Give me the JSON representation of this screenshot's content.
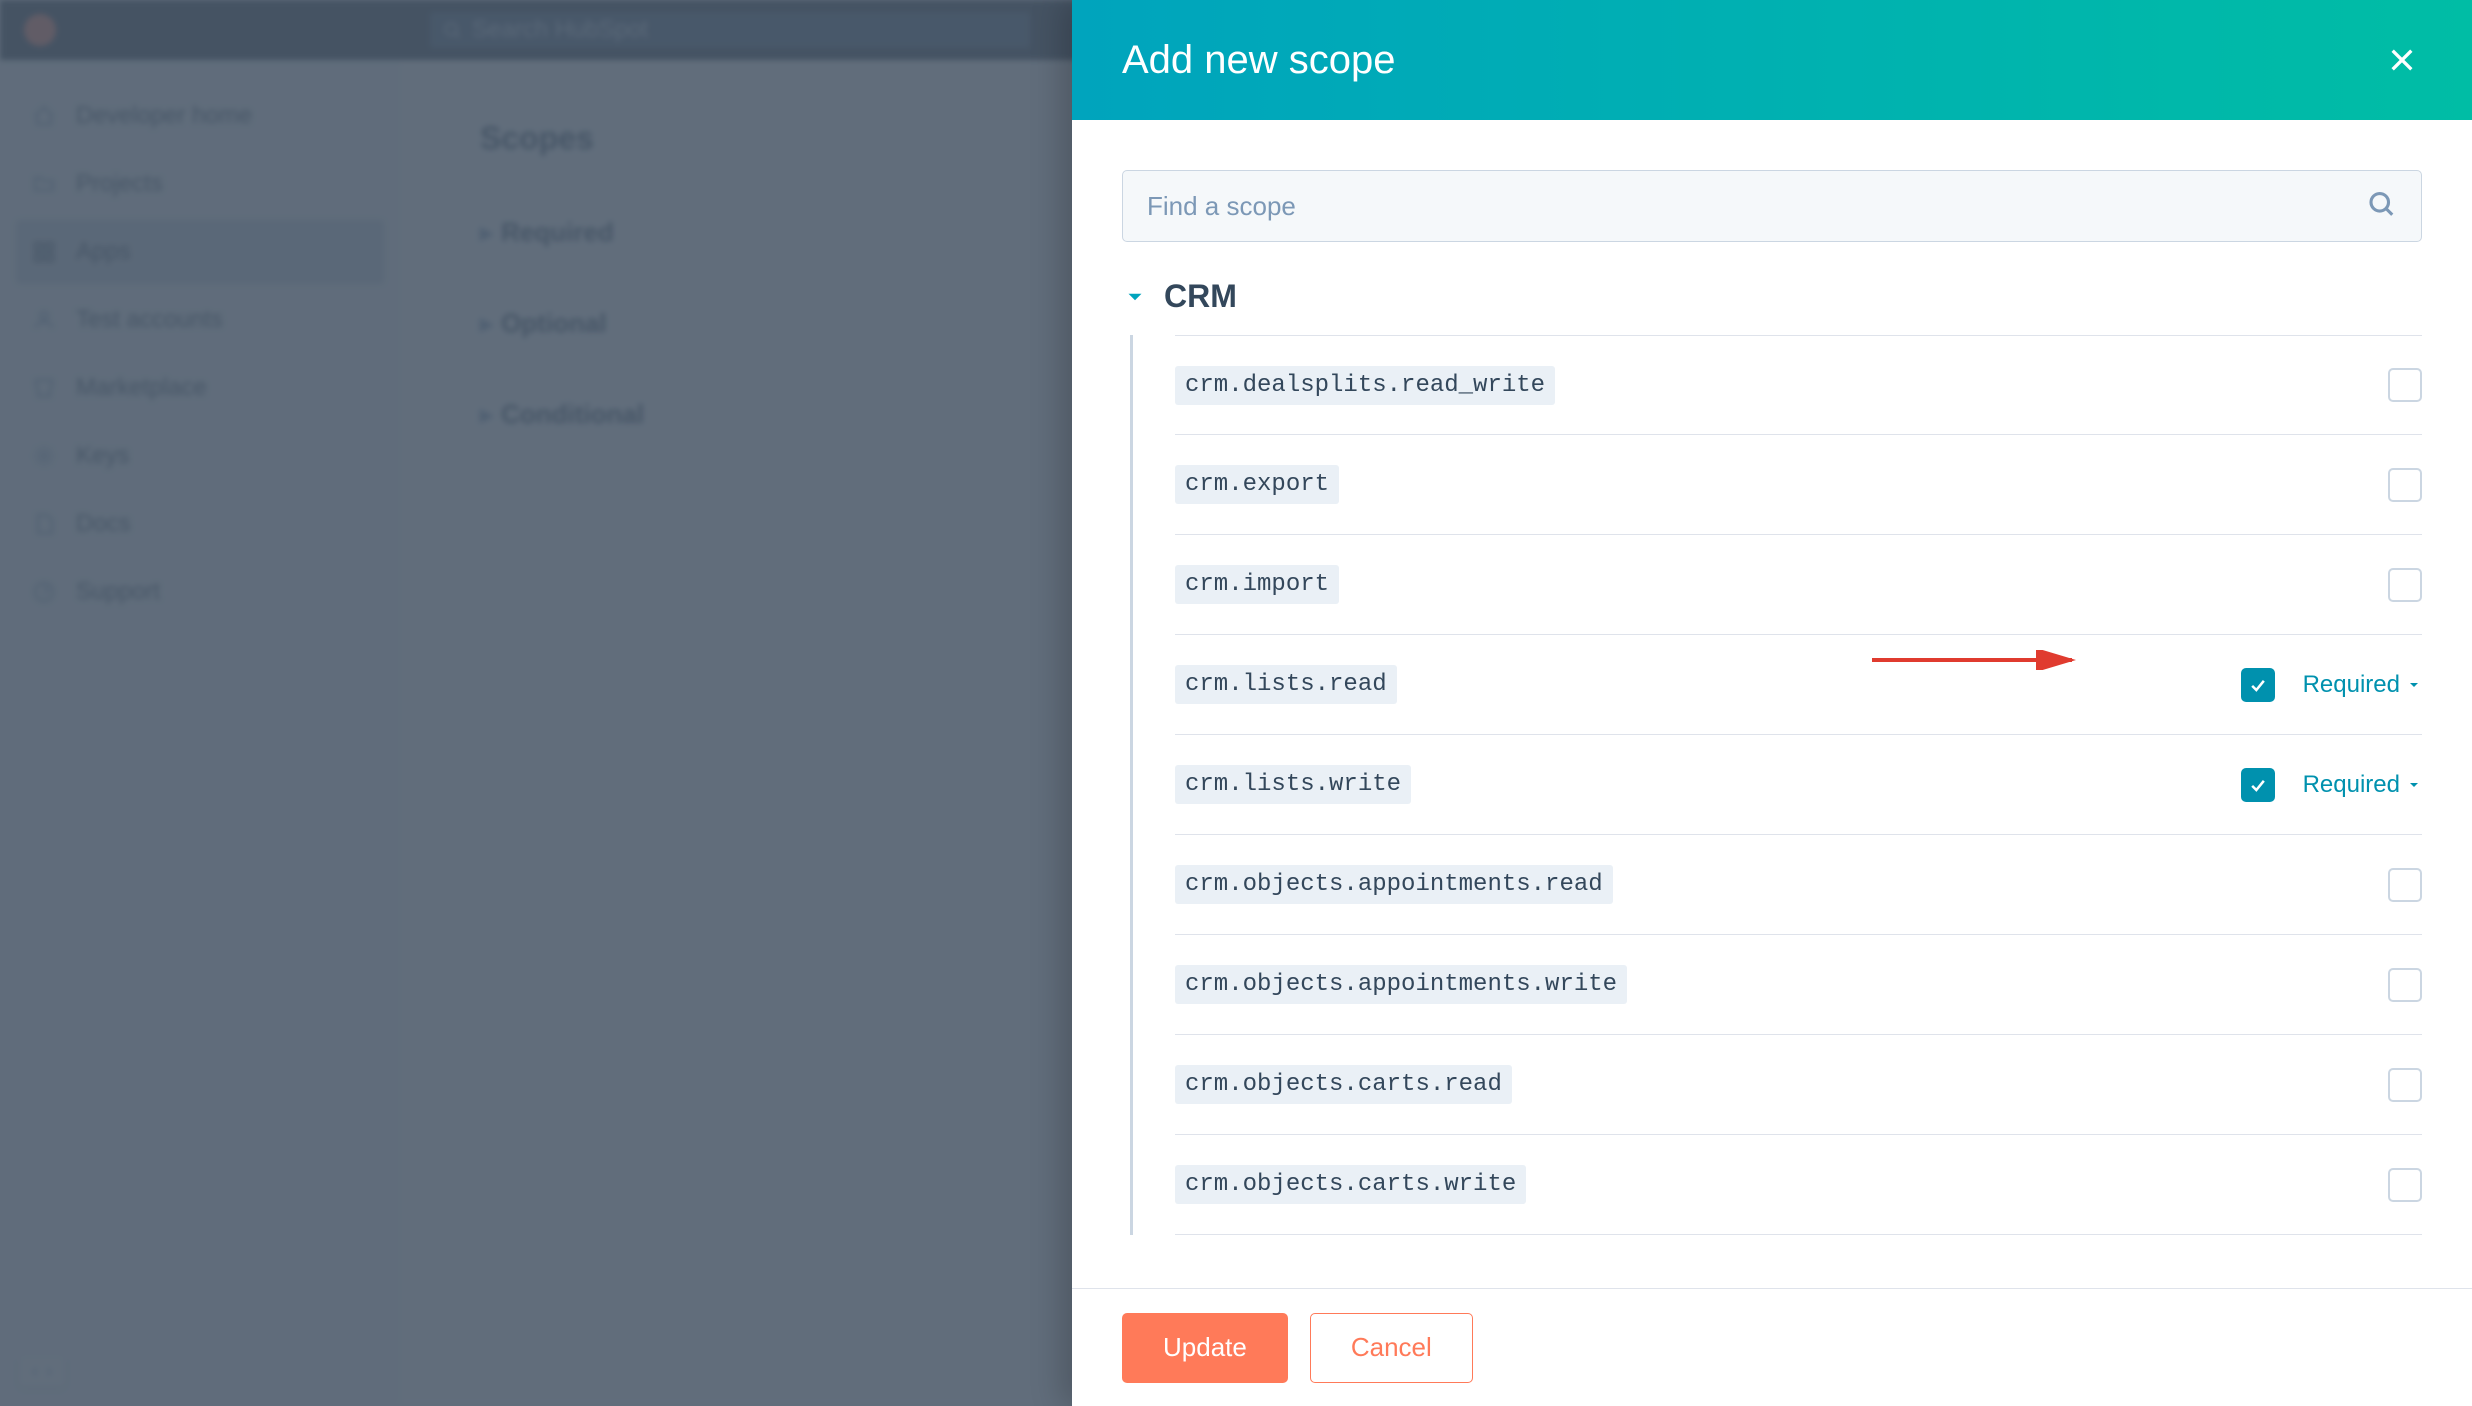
{
  "topbar": {
    "search_placeholder": "Search HubSpot"
  },
  "sidebar": {
    "items": [
      {
        "label": "Developer home"
      },
      {
        "label": "Projects"
      },
      {
        "label": "Apps"
      },
      {
        "label": "Test accounts"
      },
      {
        "label": "Marketplace"
      },
      {
        "label": "Keys"
      },
      {
        "label": "Docs"
      },
      {
        "label": "Support"
      }
    ]
  },
  "background": {
    "section_heading": "Scopes",
    "sub_section_1": "Required",
    "sub_section_2": "Optional",
    "sub_section_3": "Conditional"
  },
  "modal": {
    "title": "Add new scope",
    "search_placeholder": "Find a scope",
    "category": "CRM",
    "scopes": [
      {
        "name": "crm.dealsplits.read_write",
        "checked": false,
        "required_label": ""
      },
      {
        "name": "crm.export",
        "checked": false,
        "required_label": ""
      },
      {
        "name": "crm.import",
        "checked": false,
        "required_label": ""
      },
      {
        "name": "crm.lists.read",
        "checked": true,
        "required_label": "Required"
      },
      {
        "name": "crm.lists.write",
        "checked": true,
        "required_label": "Required"
      },
      {
        "name": "crm.objects.appointments.read",
        "checked": false,
        "required_label": ""
      },
      {
        "name": "crm.objects.appointments.write",
        "checked": false,
        "required_label": ""
      },
      {
        "name": "crm.objects.carts.read",
        "checked": false,
        "required_label": ""
      },
      {
        "name": "crm.objects.carts.write",
        "checked": false,
        "required_label": ""
      }
    ],
    "footer": {
      "primary": "Update",
      "secondary": "Cancel"
    }
  }
}
